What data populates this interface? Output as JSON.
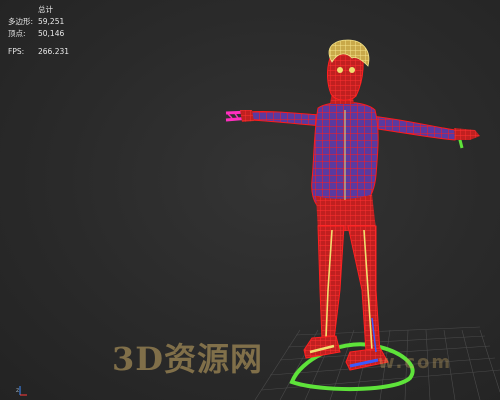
{
  "stats": {
    "header": "总计",
    "polygons_label": "多边形:",
    "polygons_value": "59,251",
    "vertices_label": "顶点:",
    "vertices_value": "50,146",
    "fps_label": "FPS:",
    "fps_value": "266.231"
  },
  "watermark": {
    "text": "3D资源网",
    "url": "w.com"
  },
  "colors": {
    "viewport_bg": "#2d2d2d",
    "wire": "#ff1a1a",
    "surface": "#5a3aa0",
    "hair": "#e8d27a",
    "bone": "#f0e070",
    "ground_ctrl": "#5ee33a",
    "hand_ctrl": "#ff2fbf",
    "foot_blue": "#3a5aff"
  },
  "icons": {
    "axis": "axis-gizmo-icon"
  }
}
